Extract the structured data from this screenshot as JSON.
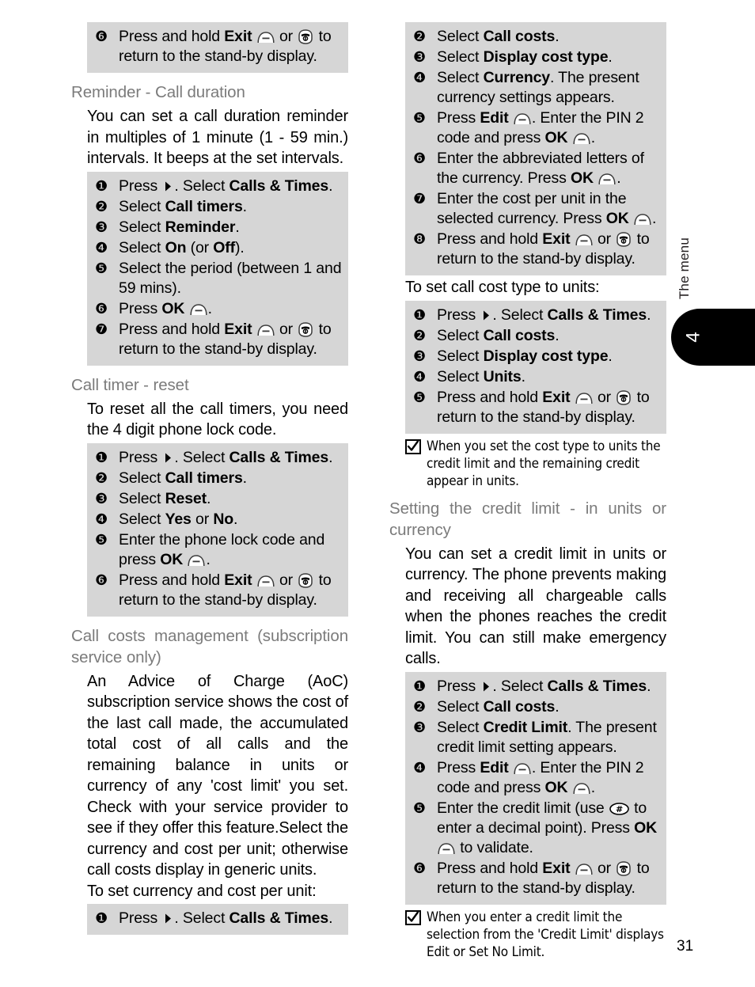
{
  "page": {
    "number": "31",
    "chapter_tab": "4",
    "edge_label": "The menu",
    "icons": {
      "softkey": "softkey-icon",
      "endcall": "end-call-key-icon",
      "hash": "hash-key-icon",
      "right": "right-arrow-key-icon",
      "tick": "checkmark-icon"
    },
    "colors": {
      "step_box": "#d6d6d6",
      "heading": "#7b7b7b",
      "tab": "#000000"
    }
  },
  "left_column": {
    "continued_steps": [
      {
        "num": "6",
        "text": "Press and hold <b>Exit</b> ICO_SOFT or ICO_END to return to the stand-by display."
      }
    ],
    "sections": [
      {
        "heading": "Reminder - Call duration",
        "paragraphs": [
          "You can set a call duration reminder in multiples of 1 minute (1 - 59 min.) intervals. It beeps at the set intervals."
        ],
        "steps": [
          {
            "num": "1",
            "text": "Press ICO_RIGHT. Select <b>Calls &amp; Times</b>."
          },
          {
            "num": "2",
            "text": "Select <b>Call timers</b>."
          },
          {
            "num": "3",
            "text": "Select <b>Reminder</b>."
          },
          {
            "num": "4",
            "text": "Select <b>On</b> (or <b>Off</b>)."
          },
          {
            "num": "5",
            "text": "Select the period (between 1 and 59 mins)."
          },
          {
            "num": "6",
            "text": "Press <b>OK</b> ICO_SOFT."
          },
          {
            "num": "7",
            "text": "Press and hold <b>Exit</b> ICO_SOFT or ICO_END to return to the stand-by display."
          }
        ]
      },
      {
        "heading": "Call timer - reset",
        "paragraphs": [
          "To reset all the call timers, you need the 4 digit phone lock code."
        ],
        "steps": [
          {
            "num": "1",
            "text": "Press ICO_RIGHT. Select <b>Calls &amp; Times</b>."
          },
          {
            "num": "2",
            "text": "Select <b>Call timers</b>."
          },
          {
            "num": "3",
            "text": "Select <b>Reset</b>."
          },
          {
            "num": "4",
            "text": "Select <b>Yes</b> or <b>No</b>."
          },
          {
            "num": "5",
            "text": "Enter the phone lock code and press <b>OK</b> ICO_SOFT."
          },
          {
            "num": "6",
            "text": "Press and hold <b>Exit</b> ICO_SOFT or ICO_END to return to the stand-by display."
          }
        ]
      },
      {
        "heading": "Call costs management (subscription service only)",
        "paragraphs": [
          "An Advice of Charge (AoC) subscription service shows the cost of the last call made, the accumulated total cost of all calls and the remaining balance in units or currency of any 'cost limit' you set. Check with your service provider to see if they offer this feature.Select the currency and cost per unit; otherwise call costs display in generic units."
        ],
        "lead_in": "To set currency and cost per unit:",
        "steps": [
          {
            "num": "1",
            "text": "Press ICO_RIGHT. Select <b>Calls &amp; Times</b>."
          }
        ]
      }
    ]
  },
  "right_column": {
    "continued_steps": [
      {
        "num": "2",
        "text": "Select <b>Call costs</b>."
      },
      {
        "num": "3",
        "text": "Select <b>Display cost type</b>."
      },
      {
        "num": "4",
        "text": "Select <b>Currency</b>. The present currency settings appears."
      },
      {
        "num": "5",
        "text": "Press <b>Edit</b> ICO_SOFT. Enter the PIN 2 code and press <b>OK</b> ICO_SOFT."
      },
      {
        "num": "6",
        "text": "Enter the abbreviated letters of the currency. Press <b>OK</b> ICO_SOFT."
      },
      {
        "num": "7",
        "text": "Enter the cost per unit in the selected currency. Press <b>OK</b> ICO_SOFT."
      },
      {
        "num": "8",
        "text": "Press and hold <b>Exit</b> ICO_SOFT or ICO_END to return to the stand-by display."
      }
    ],
    "units_lead_in": "To set call cost type to units:",
    "units_steps": [
      {
        "num": "1",
        "text": "Press ICO_RIGHT. Select <b>Calls &amp; Times</b>."
      },
      {
        "num": "2",
        "text": "Select <b>Call costs</b>."
      },
      {
        "num": "3",
        "text": "Select <b>Display cost type</b>."
      },
      {
        "num": "4",
        "text": "Select <b>Units</b>."
      },
      {
        "num": "5",
        "text": "Press and hold <b>Exit</b> ICO_SOFT or ICO_END to return to the stand-by display."
      }
    ],
    "units_note": "When you set the cost type to units the credit limit and the remaining credit appear in units.",
    "credit_section": {
      "heading": "Setting the credit limit - in units or currency",
      "paragraphs": [
        "You can set a credit limit in units or currency. The phone prevents making and receiving all chargeable calls when the phones reaches the credit limit. You can still make emergency calls."
      ],
      "steps": [
        {
          "num": "1",
          "text": "Press ICO_RIGHT. Select <b>Calls &amp; Times</b>."
        },
        {
          "num": "2",
          "text": "Select <b>Call costs</b>."
        },
        {
          "num": "3",
          "text": "Select <b>Credit Limit</b>. The present credit limit setting appears."
        },
        {
          "num": "4",
          "text": "Press <b>Edit</b> ICO_SOFT. Enter the PIN 2 code and press <b>OK</b> ICO_SOFT."
        },
        {
          "num": "5",
          "text": "Enter the credit limit (use ICO_HASH to enter a decimal point). Press <b>OK</b> ICO_SOFT to validate."
        },
        {
          "num": "6",
          "text": "Press and hold <b>Exit</b> ICO_SOFT or ICO_END to return to the stand-by display."
        }
      ],
      "note": "When you enter a credit limit the selection from the 'Credit Limit' displays Edit or Set No Limit."
    }
  }
}
